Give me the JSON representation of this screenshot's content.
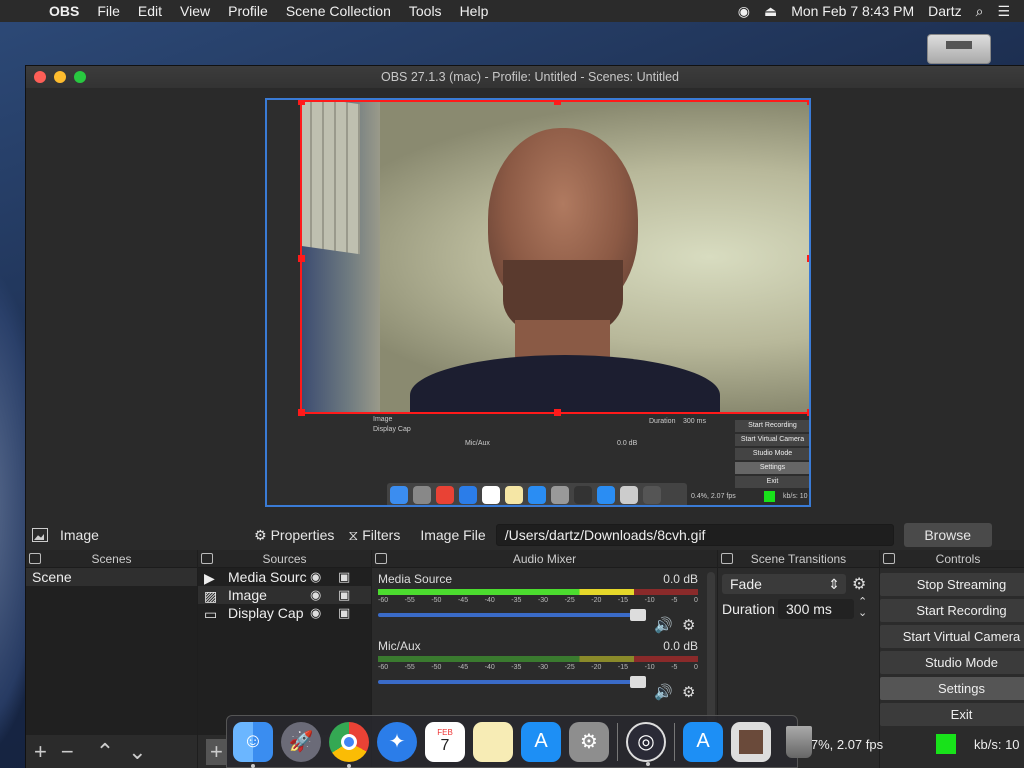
{
  "menubar": {
    "app_name": "OBS",
    "items": [
      "File",
      "Edit",
      "View",
      "Profile",
      "Scene Collection",
      "Tools",
      "Help"
    ],
    "clock": "Mon Feb 7  8:43 PM",
    "user": "Dartz"
  },
  "window": {
    "title": "OBS 27.1.3 (mac) - Profile: Untitled - Scenes: Untitled"
  },
  "preview_mini": {
    "sources": [
      "Image",
      "Display Cap"
    ],
    "mic": "Mic/Aux",
    "db": "0.0 dB",
    "duration_label": "Duration",
    "duration_value": "300 ms",
    "buttons": [
      "Start Recording",
      "Start Virtual Camera",
      "Studio Mode",
      "Settings",
      "Exit"
    ],
    "status": "0.4%, 2.07 fps",
    "kbs": "kb/s: 10"
  },
  "toolbar": {
    "source_name": "Image",
    "properties": "Properties",
    "filters": "Filters",
    "file_label": "Image File",
    "file_path": "/Users/dartz/Downloads/8cvh.gif",
    "browse": "Browse"
  },
  "scenes": {
    "title": "Scenes",
    "items": [
      "Scene"
    ]
  },
  "sources": {
    "title": "Sources",
    "items": [
      "Media Sourc",
      "Image",
      "Display Cap"
    ]
  },
  "mixer": {
    "title": "Audio Mixer",
    "channels": [
      {
        "name": "Media Source",
        "db": "0.0 dB"
      },
      {
        "name": "Mic/Aux",
        "db": "0.0 dB"
      }
    ],
    "ticks": [
      "-60",
      "-55",
      "-50",
      "-45",
      "-40",
      "-35",
      "-30",
      "-25",
      "-20",
      "-15",
      "-10",
      "-5",
      "0"
    ]
  },
  "transitions": {
    "title": "Scene Transitions",
    "type": "Fade",
    "duration_label": "Duration",
    "duration_value": "300 ms"
  },
  "controls": {
    "title": "Controls",
    "buttons": [
      "Stop Streaming",
      "Start Recording",
      "Start Virtual Camera",
      "Studio Mode",
      "Settings",
      "Exit"
    ]
  },
  "statusbar": {
    "cpu_fps": "0.7%, 2.07 fps",
    "kbs": "kb/s: 10"
  },
  "dock_calendar": {
    "month": "FEB",
    "day": "7"
  },
  "colors": {
    "selection": "#ff1a1a",
    "canvas_border": "#3a7bd5",
    "stream_indicator": "#18e21a",
    "volume": "#3a6bc8"
  }
}
